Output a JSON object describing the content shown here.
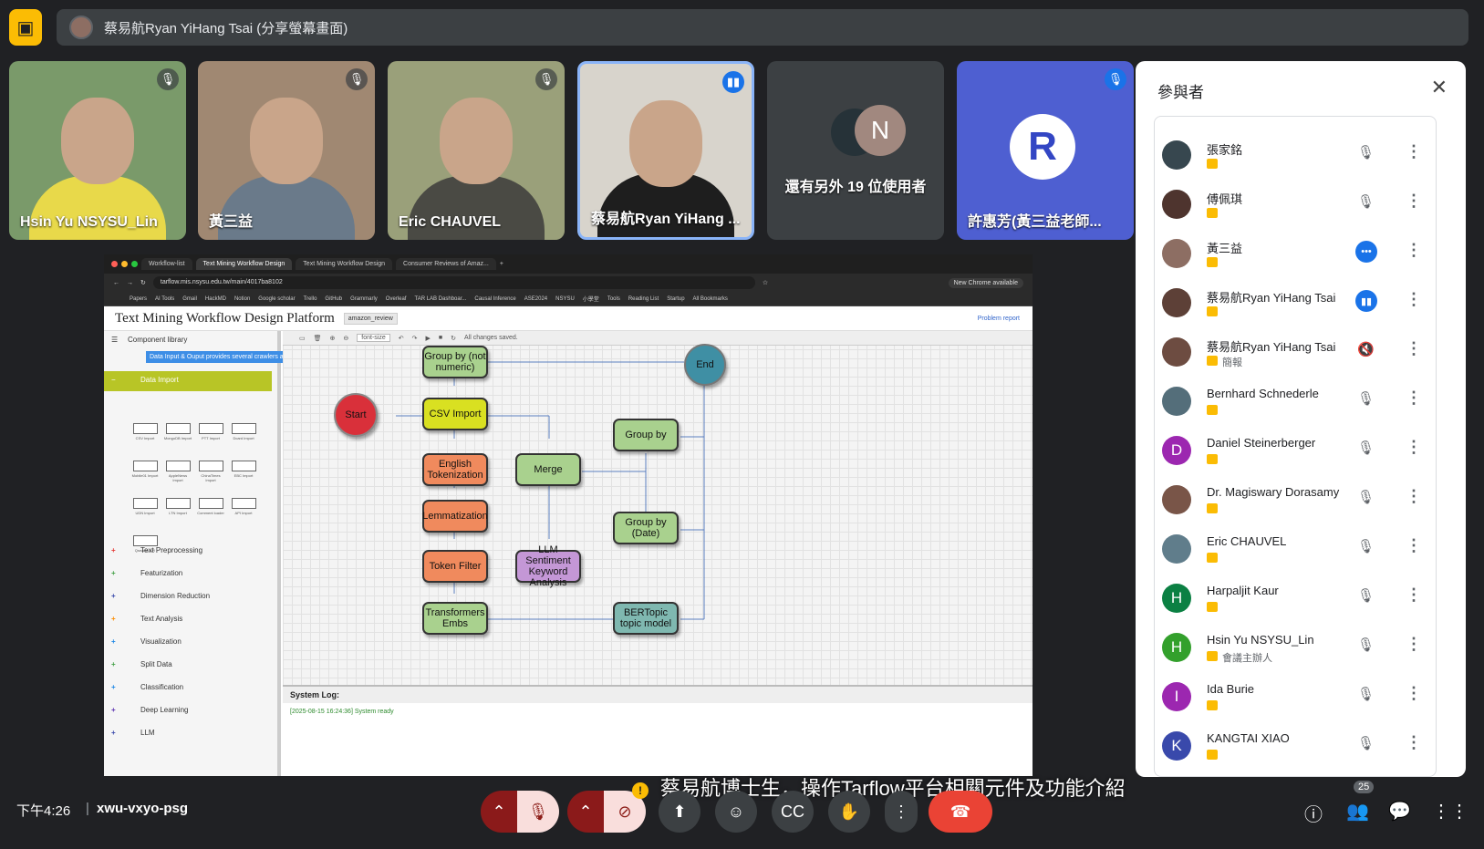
{
  "presenter_bar": {
    "title": "蔡易航Ryan YiHang Tsai (分享螢幕畫面)"
  },
  "tiles": [
    {
      "name": "Hsin Yu NSYSU_Lin",
      "bg": "#7a9a6a",
      "shirt": "#e8d94a"
    },
    {
      "name": "黃三益",
      "bg": "#a08872",
      "shirt": "#6a7a8a"
    },
    {
      "name": "Eric CHAUVEL",
      "bg": "#9aa07a",
      "shirt": "#4a4a44"
    },
    {
      "name": "蔡易航Ryan YiHang ...",
      "bg": "#d8d4cc",
      "shirt": "#1e1e1e"
    },
    {
      "name": "還有另外 19 位使用者",
      "initial": "N"
    },
    {
      "name": "許惠芳(黃三益老師...",
      "logo": "R"
    }
  ],
  "browser": {
    "tabs": [
      "Workflow-list",
      "Text Mining Workflow Design",
      "Text Mining Workflow Design",
      "Consumer Reviews of Amaz..."
    ],
    "url": "tarflow.mis.nsysu.edu.tw/main/4017ba8102",
    "chrome_badge": "New Chrome available",
    "bookmarks": [
      "Papers",
      "AI Tools",
      "Gmail",
      "HackMD",
      "Notion",
      "Google scholar",
      "Trello",
      "GitHub",
      "Grammarly",
      "Overleaf",
      "TAR LAB Dashboar...",
      "Causal Inference",
      "ASE2024",
      "NSYSU",
      "小學堂",
      "Tools",
      "Reading List",
      "Startup",
      "All Bookmarks"
    ]
  },
  "app": {
    "title": "Text Mining Workflow Design Platform",
    "project": "amazon_review",
    "problem_report": "Problem report",
    "component_library": "Component library",
    "tooltip": "Data Input & Ouput provides several crawlers and other data-input tasks",
    "data_import": "Data Import",
    "components": [
      "CSV Import",
      "MongoDB Import",
      "PTT Import",
      "Dcard Import",
      "Mobile01 Import",
      "AppleNews Import",
      "ChinaTimes Import",
      "EBC Import",
      "UDN Import",
      "LTN Import",
      "Comment loader",
      "API Import",
      "Qsearch API"
    ],
    "categories": [
      "Text Preprocessing",
      "Featurization",
      "Dimension Reduction",
      "Text Analysis",
      "Visualization",
      "Split Data",
      "Classification",
      "Deep Learning",
      "LLM"
    ],
    "toolbar_font": "font-size",
    "saved_status": "All changes saved.",
    "nodes": {
      "start": "Start",
      "end": "End",
      "group_by_nonnumeric": "Group by (not numeric)",
      "csv_import": "CSV Import",
      "english_tokenization": "English Tokenization",
      "lemmatization": "Lemmatization",
      "token_filter": "Token Filter",
      "transformers_embs": "Transformers Embs",
      "merge": "Merge",
      "llm_sentiment": "LLM Sentiment Keyword Analysis",
      "group_by": "Group by",
      "group_by_date": "Group by (Date)",
      "bertopic": "BERTopic topic model"
    },
    "system_log_title": "System Log:",
    "system_log_line": "[2025-08-15 16:24:36] System ready"
  },
  "panel": {
    "title": "參與者",
    "participants": [
      {
        "name": "張家銘",
        "sub": "",
        "initial": "",
        "color": "#37474f",
        "state": "muted"
      },
      {
        "name": "傅佩琪",
        "sub": "",
        "initial": "",
        "color": "#4e342e",
        "state": "muted"
      },
      {
        "name": "黃三益",
        "sub": "",
        "initial": "",
        "color": "#8d6e63",
        "state": "speaking"
      },
      {
        "name": "蔡易航Ryan YiHang Tsai",
        "sub": "",
        "initial": "",
        "color": "#5d4037",
        "state": "active"
      },
      {
        "name": "蔡易航Ryan YiHang Tsai",
        "sub": "簡報",
        "initial": "",
        "color": "#6d4c41",
        "state": "presenting"
      },
      {
        "name": "Bernhard Schnederle",
        "sub": "",
        "initial": "",
        "color": "#546e7a",
        "state": "muted"
      },
      {
        "name": "Daniel Steinerberger",
        "sub": "",
        "initial": "D",
        "color": "#9c27b0",
        "state": "muted"
      },
      {
        "name": "Dr. Magiswary Dorasamy",
        "sub": "",
        "initial": "",
        "color": "#795548",
        "state": "muted"
      },
      {
        "name": "Eric CHAUVEL",
        "sub": "",
        "initial": "",
        "color": "#607d8b",
        "state": "muted"
      },
      {
        "name": "Harpaljit Kaur",
        "sub": "",
        "initial": "H",
        "color": "#0b8043",
        "state": "muted"
      },
      {
        "name": "Hsin Yu NSYSU_Lin",
        "sub": "會議主辦人",
        "initial": "H",
        "color": "#33a02c",
        "state": "muted"
      },
      {
        "name": "Ida Burie",
        "sub": "",
        "initial": "I",
        "color": "#9c27b0",
        "state": "muted"
      },
      {
        "name": "KANGTAI XIAO",
        "sub": "",
        "initial": "K",
        "color": "#3949ab",
        "state": "muted"
      }
    ]
  },
  "bottom": {
    "time": "下午4:26",
    "meeting_code": "xwu-vxyo-psg",
    "caption": "蔡易航博士生，操作Tarflow平台相關元件及功能介紹",
    "participant_count": "25"
  }
}
